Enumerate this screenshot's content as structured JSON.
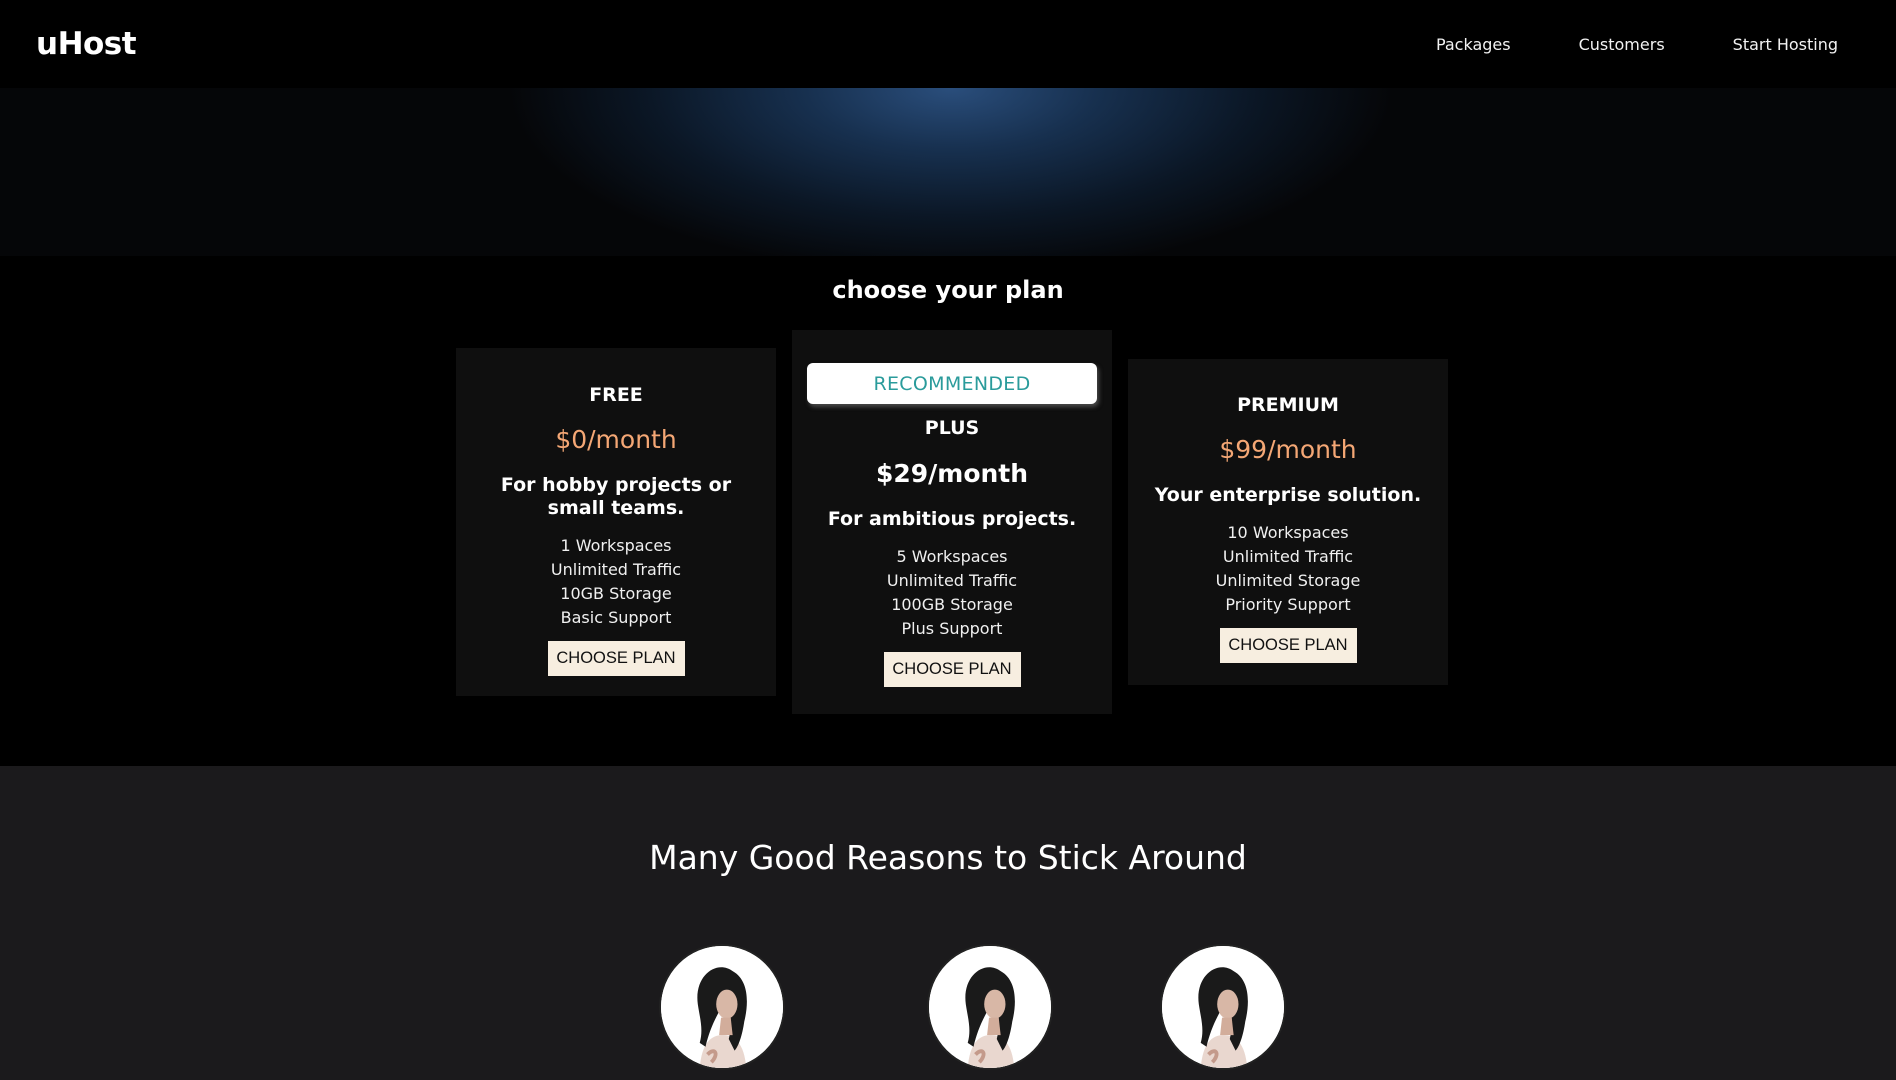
{
  "header": {
    "brand": "uHost",
    "nav": [
      "Packages",
      "Customers",
      "Start Hosting"
    ]
  },
  "plans_section": {
    "title": "choose your plan",
    "plans": [
      {
        "name": "FREE",
        "price": "$0/month",
        "description": "For hobby projects or small teams.",
        "features": [
          "1 Workspaces",
          "Unlimited Traffic",
          "10GB Storage",
          "Basic Support"
        ],
        "button": "CHOOSE PLAN"
      },
      {
        "badge": "RECOMMENDED",
        "name": "PLUS",
        "price": "$29/month",
        "description": "For ambitious projects.",
        "features": [
          "5 Workspaces",
          "Unlimited Traffic",
          "100GB Storage",
          "Plus Support"
        ],
        "button": "CHOOSE PLAN"
      },
      {
        "name": "PREMIUM",
        "price": "$99/month",
        "description": "Your enterprise solution.",
        "features": [
          "10 Workspaces",
          "Unlimited Traffic",
          "Unlimited Storage",
          "Priority Support"
        ],
        "button": "CHOOSE PLAN"
      }
    ]
  },
  "reasons": {
    "title": "Many Good Reasons to Stick Around"
  },
  "colors": {
    "accent_price": "#f4a775",
    "badge_text": "#2a9b9b",
    "button_bg": "#f7eee0",
    "reasons_bg": "#1b1a1c"
  }
}
